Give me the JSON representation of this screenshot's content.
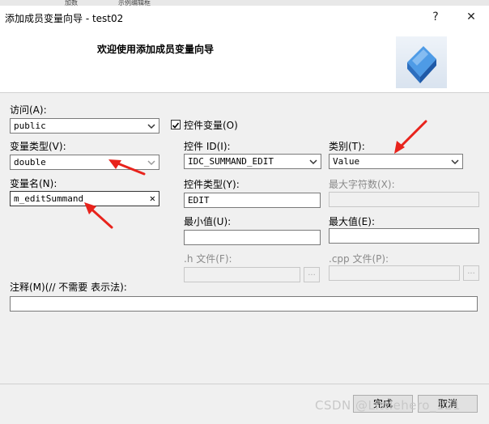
{
  "background_tabs": [
    "加数",
    "示例编辑框"
  ],
  "window": {
    "title": "添加成员变量向导 - test02",
    "help_glyph": "?",
    "close_glyph": "✕"
  },
  "header": {
    "welcome": "欢迎使用添加成员变量向导"
  },
  "form": {
    "access": {
      "label": "访问(A):",
      "value": "public"
    },
    "var_type": {
      "label": "变量类型(V):",
      "value": "double"
    },
    "var_name": {
      "label": "变量名(N):",
      "value": "m_editSummand",
      "clear_glyph": "✕"
    },
    "control_var": {
      "label": "控件变量(O)",
      "checked": true
    },
    "control_id": {
      "label": "控件 ID(I):",
      "value": "IDC_SUMMAND_EDIT"
    },
    "category": {
      "label": "类别(T):",
      "value": "Value"
    },
    "control_type": {
      "label": "控件类型(Y):",
      "value": "EDIT"
    },
    "max_chars": {
      "label": "最大字符数(X):",
      "value": ""
    },
    "min_value": {
      "label": "最小值(U):",
      "value": ""
    },
    "max_value": {
      "label": "最大值(E):",
      "value": ""
    },
    "h_file": {
      "label": ".h 文件(F):",
      "value": "",
      "browse": "..."
    },
    "cpp_file": {
      "label": ".cpp 文件(P):",
      "value": "",
      "browse": "..."
    },
    "comment": {
      "label": "注释(M)(// 不需要 表示法):",
      "value": ""
    }
  },
  "footer": {
    "finish": "完成",
    "cancel": "取消"
  },
  "watermark": "CSDN @Littlehero_121",
  "colors": {
    "annotation_arrow": "#e8231c",
    "logo_cube": "#3a86d8"
  }
}
